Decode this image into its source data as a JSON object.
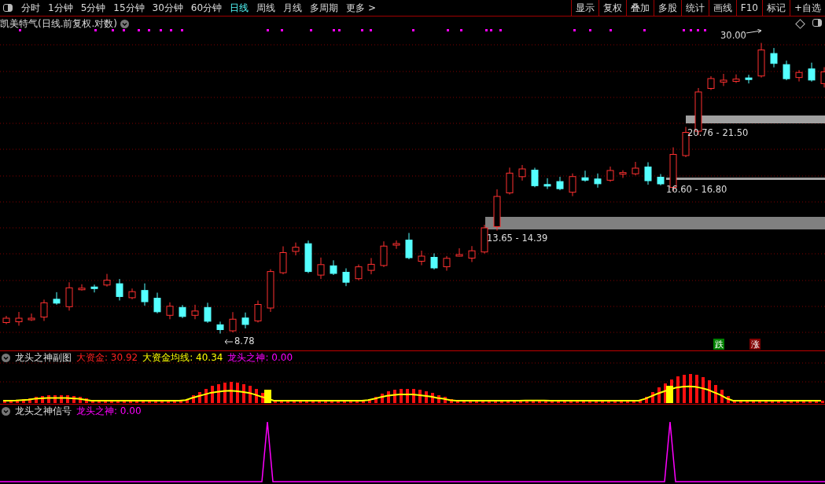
{
  "toolbar": {
    "periods": [
      {
        "label": "分时",
        "selected": false
      },
      {
        "label": "1分钟",
        "selected": false
      },
      {
        "label": "5分钟",
        "selected": false
      },
      {
        "label": "15分钟",
        "selected": false
      },
      {
        "label": "30分钟",
        "selected": false
      },
      {
        "label": "60分钟",
        "selected": false
      },
      {
        "label": "日线",
        "selected": true
      },
      {
        "label": "周线",
        "selected": false
      },
      {
        "label": "月线",
        "selected": false
      },
      {
        "label": "多周期",
        "selected": false
      },
      {
        "label": "更多 >",
        "selected": false
      }
    ],
    "buttons": [
      "显示",
      "复权",
      "叠加",
      "多股",
      "统计",
      "画线",
      "F10",
      "标记",
      "+自选"
    ]
  },
  "main_chart": {
    "title": "凯美特气(日线.前复权.对数)",
    "high_marker": "30.00",
    "low_marker": "8.78",
    "zones": [
      {
        "label": "13.65 - 14.39"
      },
      {
        "label": "16.60 - 16.80"
      },
      {
        "label": "20.76 - 21.50"
      }
    ],
    "signals": [
      {
        "kind": "fall",
        "label": "跌"
      },
      {
        "kind": "rise",
        "label": "涨"
      }
    ]
  },
  "indicator_panel": {
    "title": "龙头之神副图",
    "legend": [
      {
        "label": "大资金: 30.92",
        "color": "#ff2020"
      },
      {
        "label": "大资金均线: 40.34",
        "color": "#ffff00"
      },
      {
        "label": "龙头之神: 0.00",
        "color": "#ff00ff"
      }
    ]
  },
  "signal_panel": {
    "title": "龙头之神信号",
    "legend": [
      {
        "label": "龙头之神: 0.00",
        "color": "#ff00ff"
      }
    ]
  }
}
